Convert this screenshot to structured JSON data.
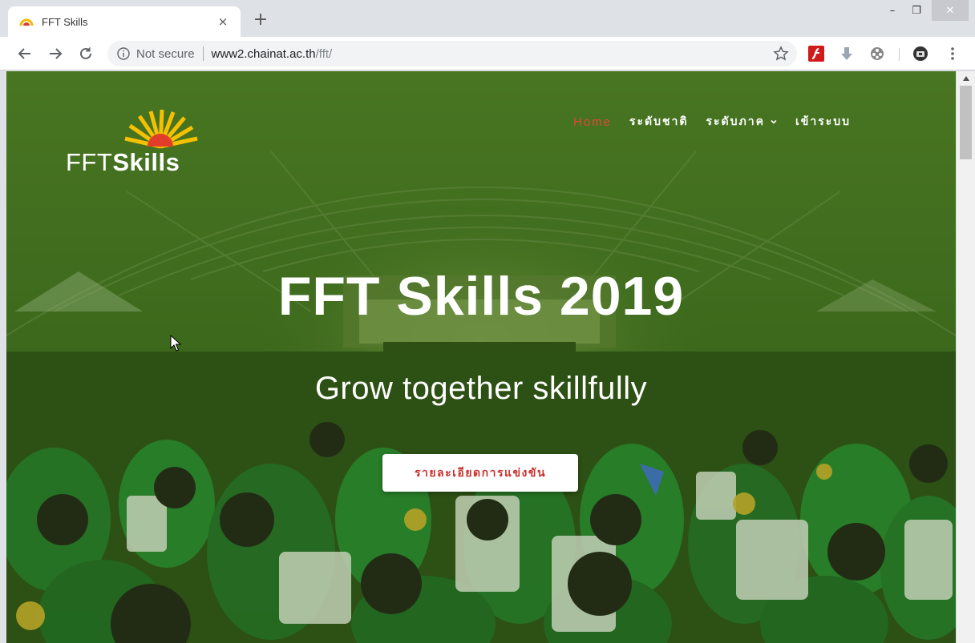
{
  "browser": {
    "tab_title": "FFT Skills",
    "tab_close": "×",
    "new_tab": "+",
    "security_label": "Not secure",
    "url_host": "www2.chainat.ac.th",
    "url_path": "/fft/",
    "window_controls": {
      "minimize": "–",
      "maximize": "❐",
      "close": "✕"
    }
  },
  "site": {
    "logo": {
      "text_light": "FFT",
      "text_bold": "Skills"
    },
    "menu": [
      {
        "label": "Home",
        "active": true
      },
      {
        "label": "ระดับชาติ",
        "active": false
      },
      {
        "label": "ระดับภาค",
        "active": false,
        "has_dropdown": true
      },
      {
        "label": "เข้าระบบ",
        "active": false
      }
    ],
    "hero": {
      "title": "FFT Skills 2019",
      "subtitle": "Grow together skillfully",
      "cta_label": "รายละเอียดการแข่งขัน"
    }
  },
  "colors": {
    "active_menu": "#e2473a",
    "cta_text": "#c9302c",
    "hero_overlay": "#3d6b1a"
  }
}
